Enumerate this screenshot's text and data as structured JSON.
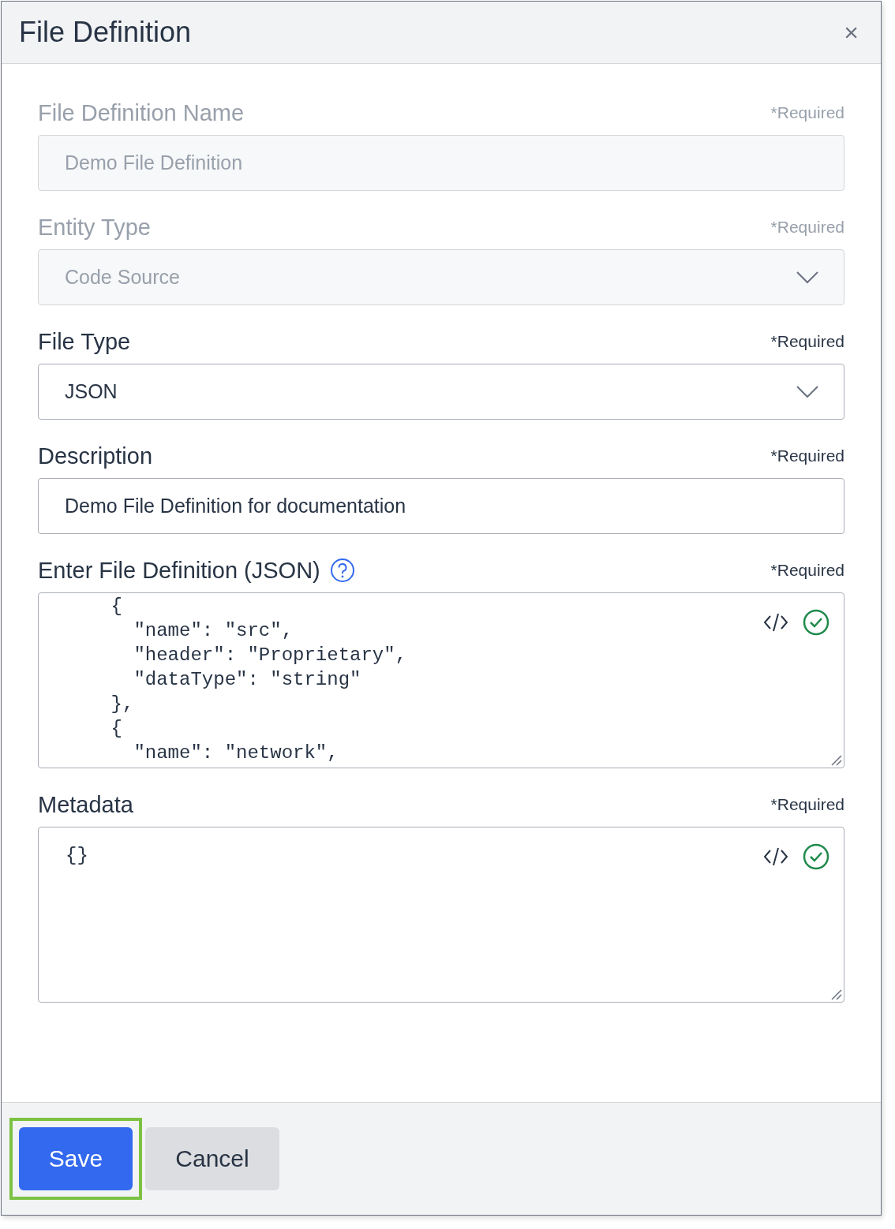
{
  "dialog": {
    "title": "File Definition",
    "close": "×"
  },
  "fields": [
    {
      "kind": "text",
      "label": "File Definition Name",
      "required": "*Required",
      "value": "Demo File Definition",
      "disabled": true
    },
    {
      "kind": "select",
      "label": "Entity Type",
      "required": "*Required",
      "value": "Code Source",
      "disabled": true
    },
    {
      "kind": "select",
      "label": "File Type",
      "required": "*Required",
      "value": "JSON",
      "disabled": false
    },
    {
      "kind": "text",
      "label": "Description",
      "required": "*Required",
      "value": "Demo File Definition for documentation",
      "disabled": false
    },
    {
      "kind": "code",
      "label": "Enter File Definition (JSON)",
      "help": true,
      "required": "*Required",
      "valid": true,
      "scrolled": true,
      "lines": [
        "    {",
        "      \"name\": \"src\",",
        "      \"header\": \"Proprietary\",",
        "      \"dataType\": \"string\"",
        "    },",
        "    {",
        "      \"name\": \"network\","
      ]
    },
    {
      "kind": "code",
      "label": "Metadata",
      "required": "*Required",
      "valid": true,
      "scrolled": false,
      "lines": [
        "{}"
      ]
    }
  ],
  "footer": {
    "buttons": [
      {
        "label": "Save",
        "primary": true,
        "highlighted": true
      },
      {
        "label": "Cancel",
        "primary": false,
        "highlighted": false
      }
    ]
  }
}
